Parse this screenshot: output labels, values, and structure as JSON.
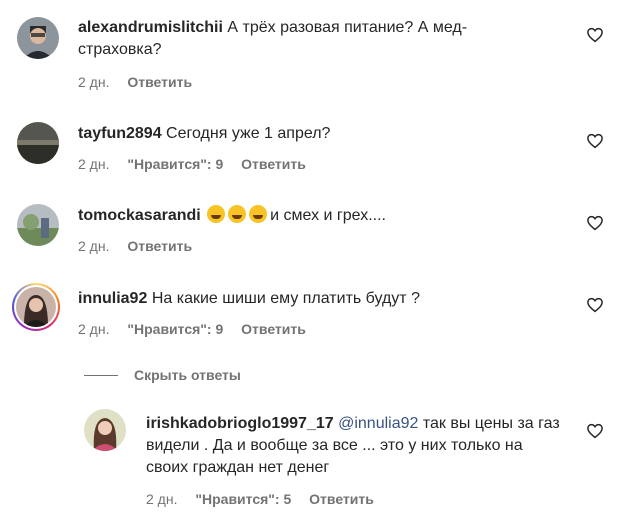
{
  "comments": [
    {
      "username": "alexandrumislitchii",
      "text": "А трёх разовая питание? А мед-страховка?",
      "age": "2 дн.",
      "likes": "",
      "reply": "Ответить"
    },
    {
      "username": "tayfun2894",
      "text": "Сегодня уже 1 апрел?",
      "age": "2 дн.",
      "likes": "\"Нравится\": 9",
      "reply": "Ответить"
    },
    {
      "username": "tomockasarandi",
      "text": "и смех и грех....",
      "age": "2 дн.",
      "likes": "",
      "reply": "Ответить",
      "emojis": [
        "grinning-tears-emoji",
        "grinning-tears-emoji",
        "grinning-tears-emoji"
      ]
    },
    {
      "username": "innulia92",
      "text": "На какие шиши ему платить будут ?",
      "age": "2 дн.",
      "likes": "\"Нравится\": 9",
      "reply": "Ответить"
    }
  ],
  "hide_replies_label": "Скрыть ответы",
  "reply_comment": {
    "username": "irishkadobrioglo1997_17",
    "mention": "@innulia92",
    "text": "так вы цены за газ видели . Да и вообще за все ... это у них только на своих граждан нет денег",
    "age": "2 дн.",
    "likes": "\"Нравится\": 5",
    "reply": "Ответить"
  },
  "colors": {
    "text": "#262626",
    "meta": "#737373",
    "mention": "#385185",
    "story_ring": "#d6249f"
  },
  "icons": {
    "like": "heart-outline-icon"
  }
}
